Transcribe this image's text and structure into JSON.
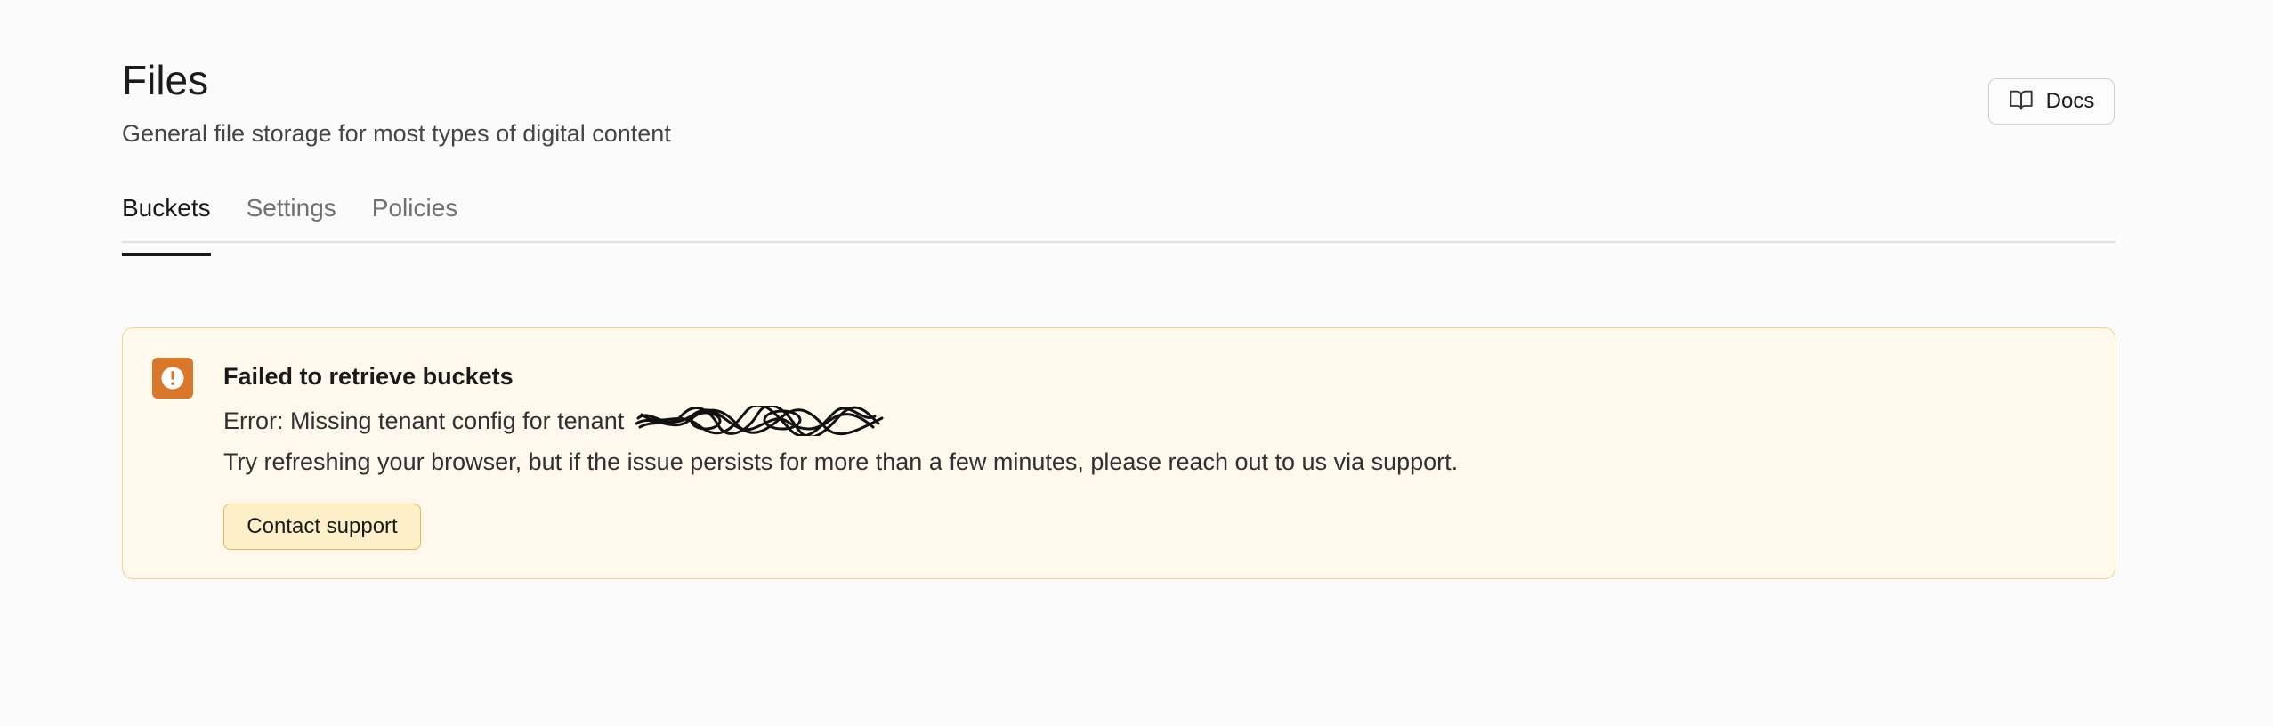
{
  "header": {
    "title": "Files",
    "subtitle": "General file storage for most types of digital content",
    "docs_label": "Docs",
    "docs_icon": "book-open-icon"
  },
  "tabs": [
    {
      "label": "Buckets",
      "active": true
    },
    {
      "label": "Settings",
      "active": false
    },
    {
      "label": "Policies",
      "active": false
    }
  ],
  "alert": {
    "icon": "alert-circle-icon",
    "title": "Failed to retrieve buckets",
    "error_prefix": "Error: Missing tenant config for tenant",
    "body": "Try refreshing your browser, but if the issue persists for more than a few minutes, please reach out to us via support.",
    "button_label": "Contact support"
  },
  "colors": {
    "background": "#fbfbfb",
    "alert_background": "#fef9ec",
    "alert_border": "#f5d38a",
    "alert_icon": "#d9772b",
    "button_background": "#fdf0c9",
    "button_border": "#e8b35a"
  }
}
